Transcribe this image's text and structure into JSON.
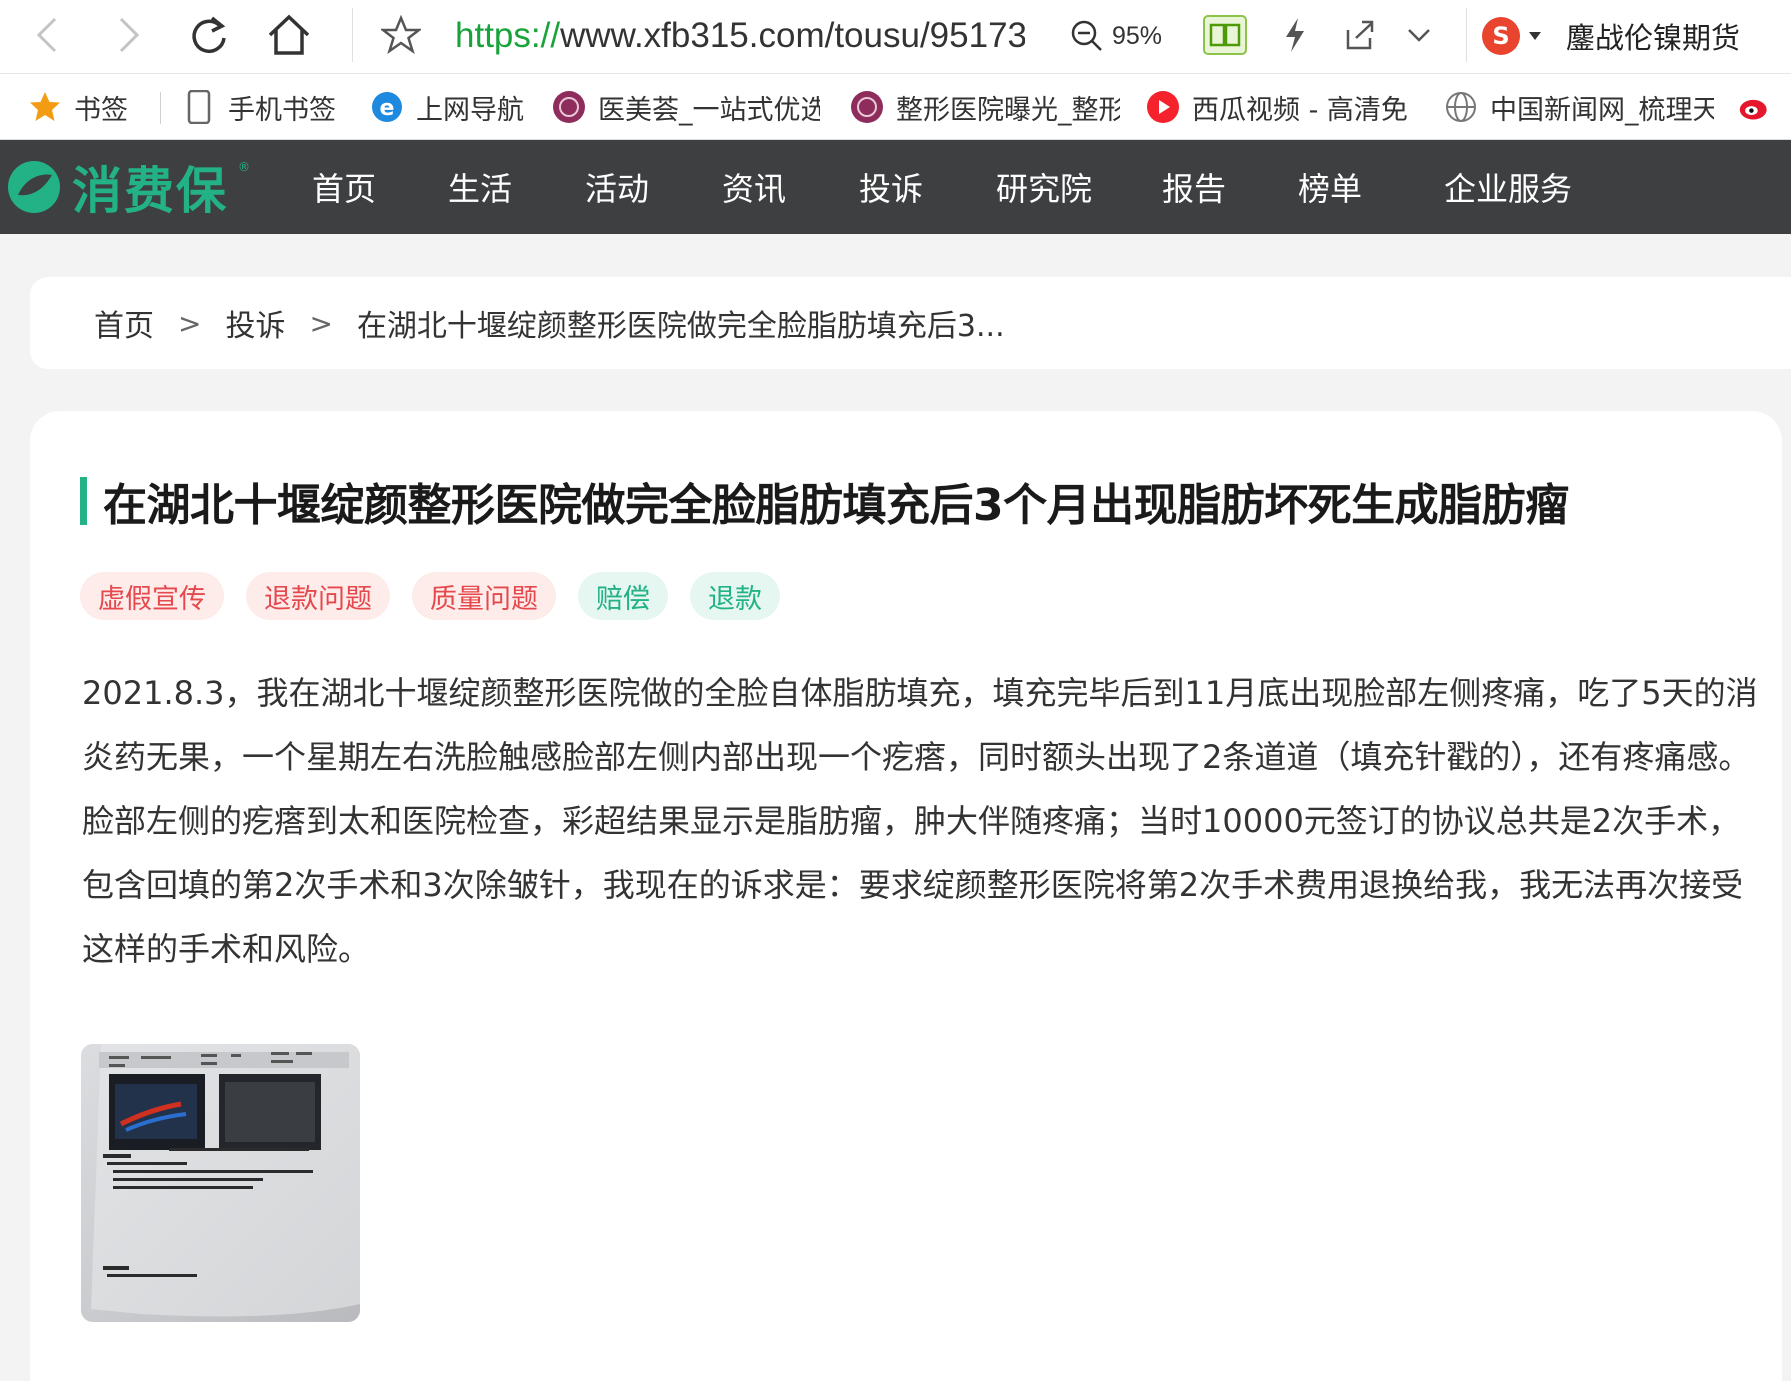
{
  "browser": {
    "url_protocol": "https://",
    "url_rest": "www.xfb315.com/tousu/95173",
    "zoom": "95%",
    "profile_name": "鏖战伦镍期货"
  },
  "bookmarks": [
    {
      "label": "书签",
      "icon": "star-icon"
    },
    {
      "label": "手机书签",
      "icon": "phone-icon"
    },
    {
      "label": "上网导航",
      "icon": "ie-icon"
    },
    {
      "label": "医美荟_一站式优选",
      "icon": "yimeihui-icon"
    },
    {
      "label": "整形医院曝光_整形",
      "icon": "yimeihui-icon"
    },
    {
      "label": "西瓜视频 - 高清免",
      "icon": "xigua-icon"
    },
    {
      "label": "中国新闻网_梳理天",
      "icon": "globe-icon"
    }
  ],
  "site": {
    "logo_text": "消费保",
    "nav": [
      "首页",
      "生活",
      "活动",
      "资讯",
      "投诉",
      "研究院",
      "报告",
      "榜单",
      "企业服务"
    ]
  },
  "breadcrumb": {
    "home": "首页",
    "section": "投诉",
    "current": "在湖北十堰绽颜整形医院做完全脸脂肪填充后3..."
  },
  "article": {
    "title": "在湖北十堰绽颜整形医院做完全脸脂肪填充后3个月出现脂肪坏死生成脂肪瘤",
    "tags_red": [
      "虚假宣传",
      "退款问题",
      "质量问题"
    ],
    "tags_green": [
      "赔偿",
      "退款"
    ],
    "body": "2021.8.3，我在湖北十堰绽颜整形医院做的全脸自体脂肪填充，填充完毕后到11月底出现脸部左侧疼痛，吃了5天的消炎药无果，一个星期左右洗脸触感脸部左侧内部出现一个疙瘩，同时额头出现了2条道道（填充针戳的），还有疼痛感。脸部左侧的疙瘩到太和医院检查，彩超结果显示是脂肪瘤，肿大伴随疼痛；当时10000元签订的协议总共是2次手术，包含回填的第2次手术和3次除皱针，我现在的诉求是：要求绽颜整形医院将第2次手术费用退换给我，我无法再次接受这样的手术和风险。"
  },
  "colors": {
    "brand_green": "#23b286",
    "nav_bg": "#3e3f40",
    "tag_red": "#e5484d",
    "url_green": "#19a33b"
  }
}
